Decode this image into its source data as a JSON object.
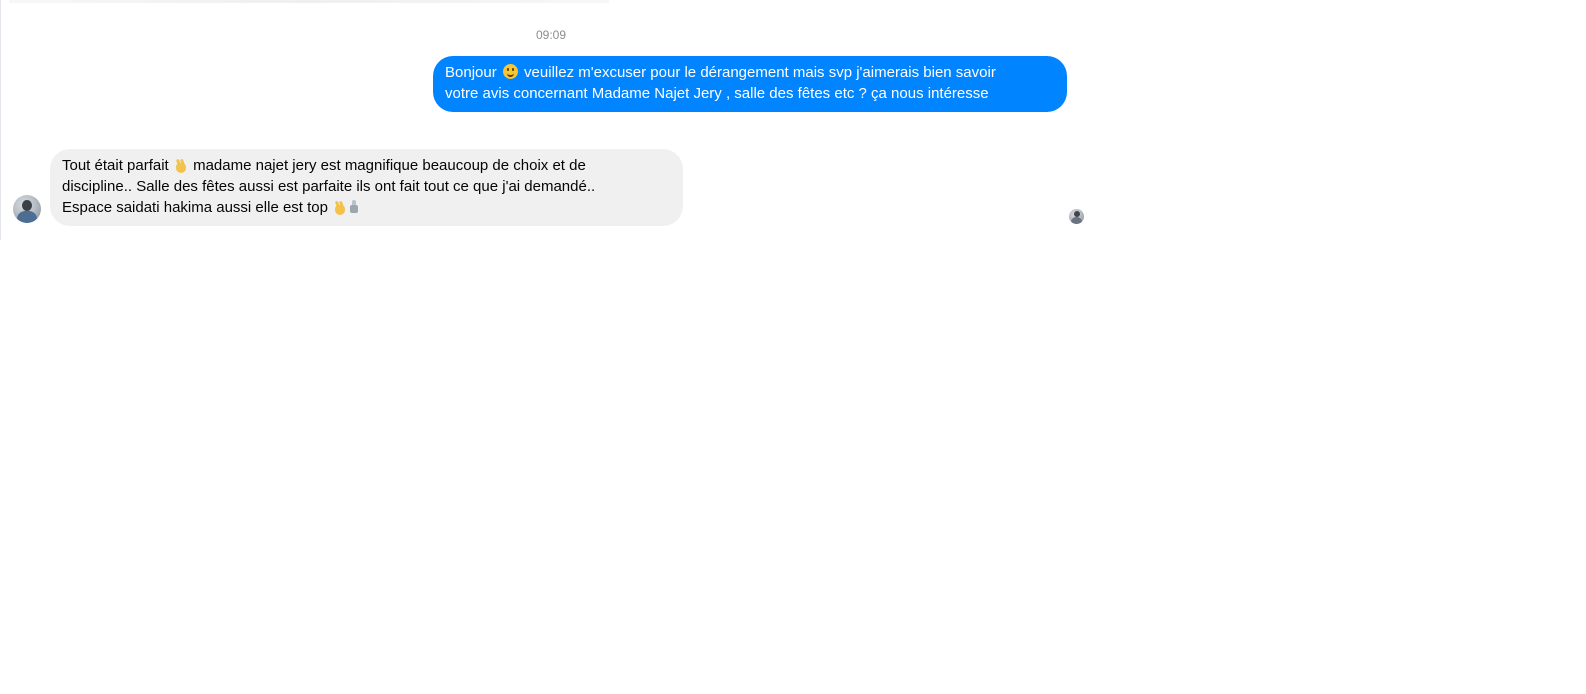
{
  "conversation": {
    "timestamp": "09:09",
    "outgoing": {
      "text_part1": "Bonjour",
      "emoji1": "slightly-smiling-face",
      "text_part2": "veuillez m'excuser pour le dérangement mais svp j'aimerais bien savoir\nvotre avis concernant Madame Najet Jery , salle des fêtes etc ? ça nous intéresse",
      "color": "#0084ff"
    },
    "incoming": {
      "text_part1": "Tout était parfait",
      "emoji1": "ok-hand",
      "text_part2": "madame najet jery est magnifique beaucoup de choix et de\ndiscipline.. Salle des fêtes aussi est parfaite ils ont fait tout ce que j'ai demandé..\nEspace saidati hakima aussi elle est top",
      "emoji2": "ok-hand",
      "emoji3": "thumbs-up",
      "color": "#f0f0f0"
    },
    "sender_avatar": "contact-avatar",
    "seen_avatar": "seen-indicator-avatar"
  }
}
